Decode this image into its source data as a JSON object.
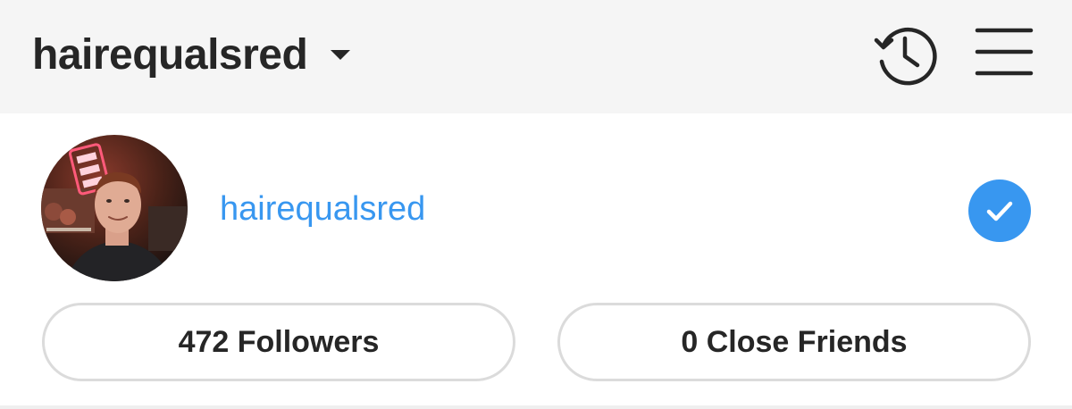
{
  "header": {
    "title": "hairequalsred",
    "switcher_icon": "chevron-down-icon",
    "history_icon": "history-icon",
    "menu_icon": "hamburger-menu-icon"
  },
  "profile": {
    "username": "hairequalsred",
    "avatar_icon": "avatar",
    "selected_icon": "checkmark-icon",
    "accent_color": "#3897f0"
  },
  "stats": {
    "followers_label": "472 Followers",
    "close_friends_label": "0 Close Friends"
  }
}
